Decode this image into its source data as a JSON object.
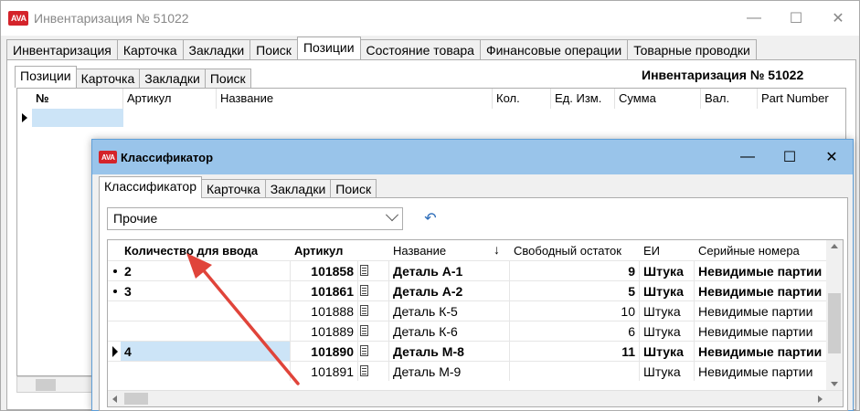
{
  "main_window": {
    "logo_text": "АVА",
    "title": "Инвентаризация № 51022",
    "tabs": [
      "Инвентаризация",
      "Карточка",
      "Закладки",
      "Поиск",
      "Позиции",
      "Состояние товара",
      "Финансовые операции",
      "Товарные проводки"
    ],
    "active_tab": 4,
    "inner_tabs": [
      "Позиции",
      "Карточка",
      "Закладки",
      "Поиск"
    ],
    "doc_title": "Инвентаризация № 51022",
    "grid_headers": {
      "num": "№",
      "article": "Артикул",
      "name": "Название",
      "qty": "Кол.",
      "unit": "Ед. Изм.",
      "sum": "Сумма",
      "currency": "Вал.",
      "part_number": "Part Number"
    }
  },
  "dialog": {
    "logo_text": "АVА",
    "title": "Классификатор",
    "tabs": [
      "Классификатор",
      "Карточка",
      "Закладки",
      "Поиск"
    ],
    "category_value": "Прочие",
    "headers": {
      "qty_input": "Количество для ввода",
      "article": "Артикул",
      "name": "Название",
      "free_stock": "Свободный остаток",
      "unit": "ЕИ",
      "serials": "Серийные номера"
    },
    "rows": [
      {
        "qty": "2",
        "article": "101858",
        "name": "Деталь А-1",
        "free": "9",
        "unit": "Штука",
        "serials": "Невидимые партии",
        "bold": true,
        "marker": "dot"
      },
      {
        "qty": "3",
        "article": "101861",
        "name": "Деталь А-2",
        "free": "5",
        "unit": "Штука",
        "serials": "Невидимые партии",
        "bold": true,
        "marker": "dot"
      },
      {
        "qty": "",
        "article": "101888",
        "name": "Деталь К-5",
        "free": "10",
        "unit": "Штука",
        "serials": "Невидимые партии",
        "bold": false,
        "marker": ""
      },
      {
        "qty": "",
        "article": "101889",
        "name": "Деталь К-6",
        "free": "6",
        "unit": "Штука",
        "serials": "Невидимые партии",
        "bold": false,
        "marker": ""
      },
      {
        "qty": "4",
        "article": "101890",
        "name": "Деталь М-8",
        "free": "11",
        "unit": "Штука",
        "serials": "Невидимые партии",
        "bold": true,
        "marker": "tri"
      },
      {
        "qty": "",
        "article": "101891",
        "name": "Деталь М-9",
        "free": "",
        "unit": "Штука",
        "serials": "Невидимые партии",
        "bold": false,
        "marker": ""
      }
    ]
  },
  "colors": {
    "brand": "#d4232a",
    "dialog_title_bg": "#99c4ea",
    "selection": "#cce4f7",
    "annotation_arrow": "#e0443a"
  },
  "icons": {
    "min": "—",
    "max": "☐",
    "close": "✕",
    "refresh": "↶"
  }
}
